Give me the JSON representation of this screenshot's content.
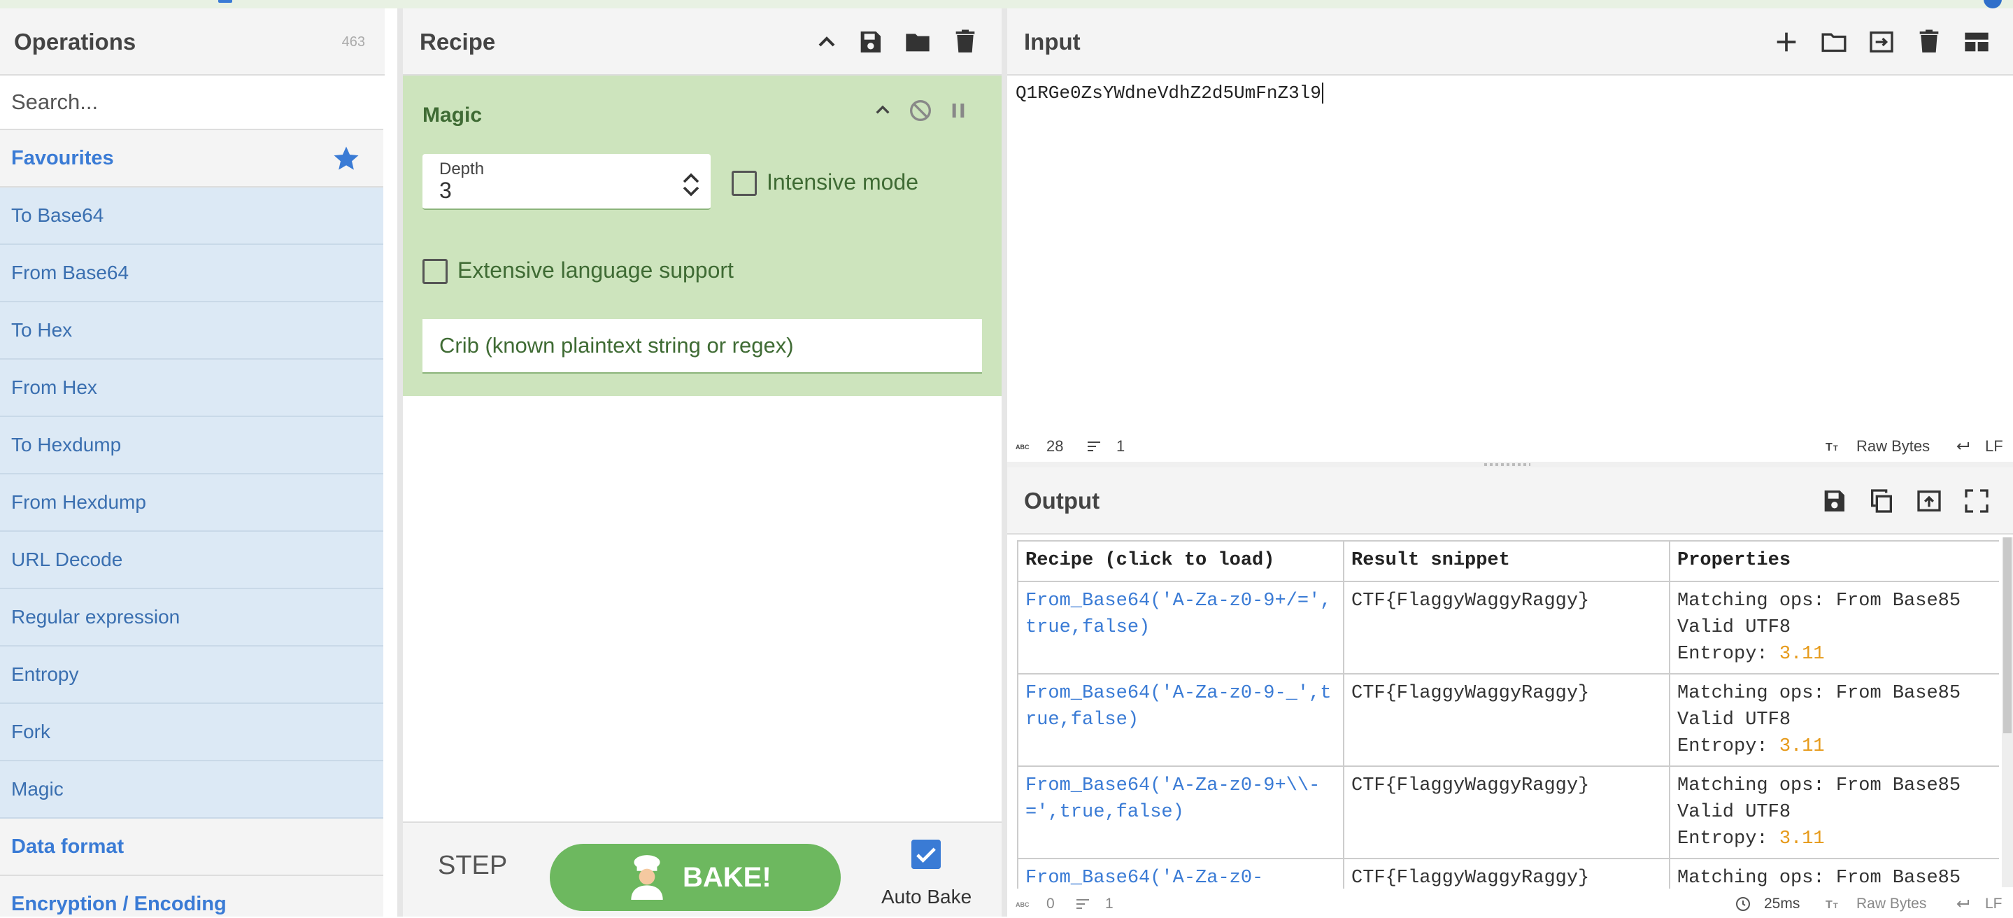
{
  "operations": {
    "title": "Operations",
    "count": "463",
    "search_placeholder": "Search...",
    "favourites_label": "Favourites",
    "items": [
      "To Base64",
      "From Base64",
      "To Hex",
      "From Hex",
      "To Hexdump",
      "From Hexdump",
      "URL Decode",
      "Regular expression",
      "Entropy",
      "Fork",
      "Magic"
    ],
    "categories": [
      "Data format",
      "Encryption / Encoding"
    ]
  },
  "recipe": {
    "title": "Recipe",
    "operation": {
      "name": "Magic",
      "depth_label": "Depth",
      "depth_value": "3",
      "intensive_label": "Intensive mode",
      "intensive_checked": false,
      "extensive_label": "Extensive language support",
      "extensive_checked": false,
      "crib_placeholder": "Crib (known plaintext string or regex)"
    },
    "step_label": "STEP",
    "bake_label": "BAKE!",
    "auto_bake_label": "Auto Bake",
    "auto_bake_checked": true
  },
  "input": {
    "title": "Input",
    "text": "Q1RGe0ZsYWdneVdhZ2d5UmFnZ3l9",
    "status": {
      "chars": "28",
      "lines": "1",
      "encoding": "Raw Bytes",
      "eol": "LF"
    }
  },
  "output": {
    "title": "Output",
    "table": {
      "headers": [
        "Recipe (click to load)",
        "Result snippet",
        "Properties"
      ],
      "rows": [
        {
          "recipe": "From_Base64('A-Za-z0-9+/=',true,false)",
          "result": "CTF{FlaggyWaggyRaggy}",
          "matching": "Matching ops: From Base85",
          "valid": "Valid UTF8",
          "entropy_label": "Entropy: ",
          "entropy": "3.11"
        },
        {
          "recipe": "From_Base64('A-Za-z0-9-_',true,false)",
          "result": "CTF{FlaggyWaggyRaggy}",
          "matching": "Matching ops: From Base85",
          "valid": "Valid UTF8",
          "entropy_label": "Entropy: ",
          "entropy": "3.11"
        },
        {
          "recipe": "From_Base64('A-Za-z0-9+\\\\-=',true,false)",
          "result": "CTF{FlaggyWaggyRaggy}",
          "matching": "Matching ops: From Base85",
          "valid": "Valid UTF8",
          "entropy_label": "Entropy: ",
          "entropy": "3.11"
        },
        {
          "recipe": "From_Base64('A-Za-z0-",
          "result": "CTF{FlaggyWaggyRaggy}",
          "matching": "Matching ops: From Base85",
          "valid": "",
          "entropy_label": "",
          "entropy": ""
        }
      ]
    },
    "status": {
      "chars": "0",
      "lines": "1",
      "time": "25ms",
      "encoding": "Raw Bytes",
      "eol": "LF"
    }
  },
  "colors": {
    "accent": "#3a7bd5",
    "recipe_bg": "#cde4bd",
    "bake": "#6db85f",
    "entropy": "#e69a1a"
  }
}
